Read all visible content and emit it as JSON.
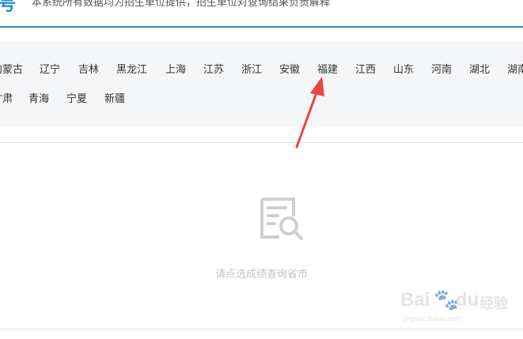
{
  "header": {
    "brand_glyph": "号",
    "notice": "本系统所有数据均为招生单位提供，招生单位对查询结果负责解释"
  },
  "provinces_row1": [
    "内蒙古",
    "辽宁",
    "吉林",
    "黑龙江",
    "上海",
    "江苏",
    "浙江",
    "安徽",
    "福建",
    "江西",
    "山东",
    "河南",
    "湖北",
    "湖南"
  ],
  "provinces_row2": [
    "甘肃",
    "青海",
    "宁夏",
    "新疆"
  ],
  "empty_state": {
    "icon": "document-search-icon",
    "message": "请点选成绩查询省市"
  },
  "annotation": {
    "target": "福建",
    "color": "#e8463e"
  },
  "watermark": {
    "logo": "Bai",
    "logo_tail": "du",
    "cn": "经验",
    "url": "jingyan.baidu.com"
  },
  "colors": {
    "accent": "#2b8bd8",
    "panel_bg": "#f5f6f8",
    "muted": "#c4c4c4"
  }
}
